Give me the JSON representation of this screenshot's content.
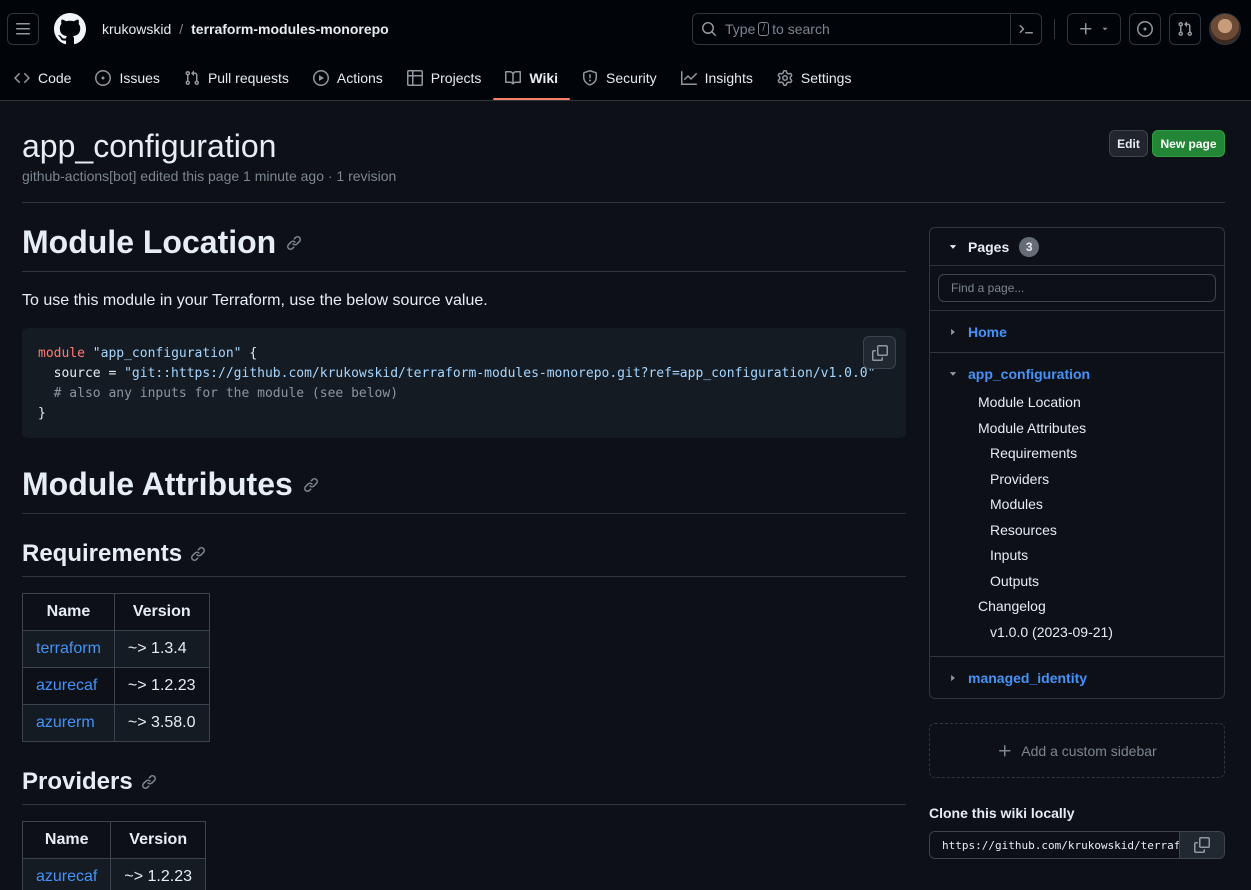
{
  "header": {
    "owner": "krukowskid",
    "separator": "/",
    "repo": "terraform-modules-monorepo",
    "search_prefix": "Type",
    "search_key": "/",
    "search_suffix": "to search"
  },
  "tabs": [
    {
      "label": "Code",
      "icon": "code-icon"
    },
    {
      "label": "Issues",
      "icon": "issue-icon"
    },
    {
      "label": "Pull requests",
      "icon": "pull-request-icon"
    },
    {
      "label": "Actions",
      "icon": "play-icon"
    },
    {
      "label": "Projects",
      "icon": "table-icon"
    },
    {
      "label": "Wiki",
      "icon": "book-icon",
      "selected": true
    },
    {
      "label": "Security",
      "icon": "shield-icon"
    },
    {
      "label": "Insights",
      "icon": "graph-icon"
    },
    {
      "label": "Settings",
      "icon": "gear-icon"
    }
  ],
  "page": {
    "title": "app_configuration",
    "meta": "github-actions[bot] edited this page 1 minute ago · 1 revision",
    "edit_label": "Edit",
    "new_page_label": "New page"
  },
  "content": {
    "h_location": "Module Location",
    "intro": "To use this module in your Terraform, use the below source value.",
    "code": {
      "kw": "module",
      "name": "\"app_configuration\"",
      "open": " {",
      "source_key": "  source = ",
      "source_val": "\"git::https://github.com/krukowskid/terraform-modules-monorepo.git?ref=app_configuration/v1.0.0\"",
      "comment": "  # also any inputs for the module (see below)",
      "close": "}"
    },
    "h_attributes": "Module Attributes",
    "h_requirements": "Requirements",
    "requirements": {
      "headers": [
        "Name",
        "Version"
      ],
      "rows": [
        [
          "terraform",
          "~> 1.3.4"
        ],
        [
          "azurecaf",
          "~> 1.2.23"
        ],
        [
          "azurerm",
          "~> 3.58.0"
        ]
      ]
    },
    "h_providers": "Providers",
    "providers": {
      "headers": [
        "Name",
        "Version"
      ],
      "rows": [
        [
          "azurecaf",
          "~> 1.2.23"
        ]
      ]
    }
  },
  "sidebar": {
    "title": "Pages",
    "count": "3",
    "search_placeholder": "Find a page...",
    "home": "Home",
    "current": "app_configuration",
    "toc": [
      {
        "label": "Module Location",
        "level": 1
      },
      {
        "label": "Module Attributes",
        "level": 1
      },
      {
        "label": "Requirements",
        "level": 2
      },
      {
        "label": "Providers",
        "level": 2
      },
      {
        "label": "Modules",
        "level": 2
      },
      {
        "label": "Resources",
        "level": 2
      },
      {
        "label": "Inputs",
        "level": 2
      },
      {
        "label": "Outputs",
        "level": 2
      },
      {
        "label": "Changelog",
        "level": 1
      },
      {
        "label": "v1.0.0 (2023-09-21)",
        "level": 2
      }
    ],
    "other": "managed_identity",
    "custom_sidebar": "Add a custom sidebar",
    "clone_title": "Clone this wiki locally",
    "clone_url": "https://github.com/krukowskid/terraform-modules-monorepo.wiki.git"
  }
}
